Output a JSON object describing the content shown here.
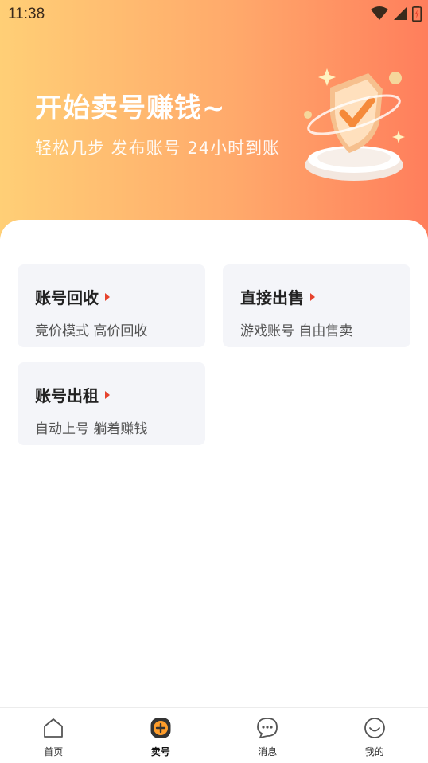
{
  "status": {
    "time": "11:38",
    "icons": [
      "wifi-icon",
      "signal-icon",
      "battery-charging-icon"
    ]
  },
  "hero": {
    "title": "开始卖号赚钱~",
    "subtitle": "轻松几步 发布账号 24小时到账",
    "illustration": "shield-check-icon"
  },
  "cards": [
    {
      "title": "账号回收",
      "desc": "竞价模式 高价回收"
    },
    {
      "title": "直接出售",
      "desc": "游戏账号 自由售卖"
    },
    {
      "title": "账号出租",
      "desc": "自动上号 躺着赚钱"
    }
  ],
  "tabs": [
    {
      "label": "首页",
      "icon": "home-icon"
    },
    {
      "label": "卖号",
      "icon": "plus-circle-icon",
      "active": true
    },
    {
      "label": "消息",
      "icon": "chat-bubble-icon"
    },
    {
      "label": "我的",
      "icon": "smiley-icon"
    }
  ],
  "colors": {
    "hero_gradient": [
      "#ffcf76",
      "#ffa96b",
      "#ff7e5c"
    ],
    "card_bg": "#f4f5f9",
    "arrow": "#e6432e",
    "active_tab": "#ff9d2a"
  }
}
